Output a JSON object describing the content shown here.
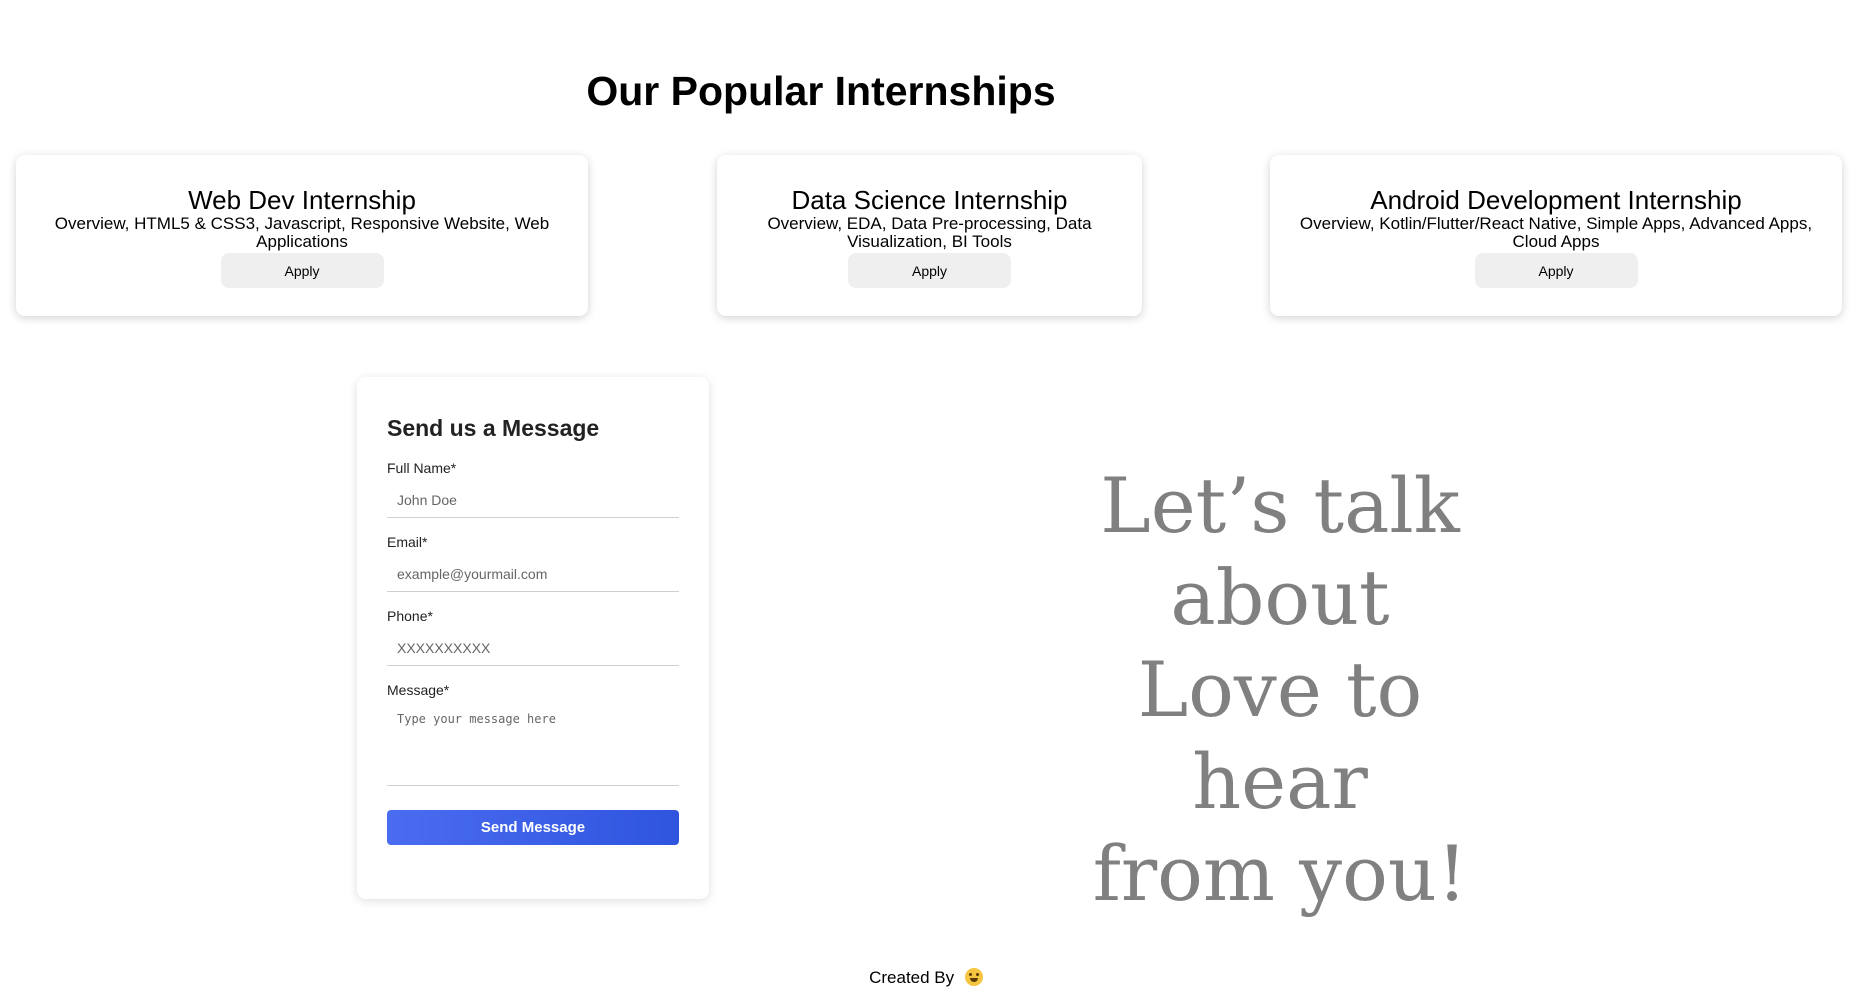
{
  "heading": "Our Popular Internships",
  "internships": [
    {
      "title": "Web Dev Internship",
      "description": "Overview, HTML5 & CSS3, Javascript, Responsive Website, Web Applications",
      "button_label": "Apply"
    },
    {
      "title": "Data Science Internship",
      "description": "Overview, EDA, Data Pre-processing, Data Visualization, BI Tools",
      "button_label": "Apply"
    },
    {
      "title": "Android Development Internship",
      "description": "Overview, Kotlin/Flutter/React Native, Simple Apps, Advanced Apps, Cloud Apps",
      "button_label": "Apply"
    }
  ],
  "contact_form": {
    "title": "Send us a Message",
    "full_name": {
      "label": "Full Name*",
      "placeholder": "John Doe",
      "value": ""
    },
    "email": {
      "label": "Email*",
      "placeholder": "example@yourmail.com",
      "value": ""
    },
    "phone": {
      "label": "Phone*",
      "placeholder": "XXXXXXXXXX",
      "value": ""
    },
    "message": {
      "label": "Message*",
      "placeholder": "Type your message here",
      "value": ""
    },
    "submit_label": "Send Message"
  },
  "talk_text": {
    "line1": "Let’s talk",
    "line2": "about",
    "line3": "Love to hear",
    "line4": "from you!"
  },
  "footer": {
    "text": "Created By",
    "emoji_icon": "smiling-face-emoji-icon"
  },
  "colors": {
    "send_button_gradient_start": "#4a6cf0",
    "send_button_gradient_end": "#2f54de",
    "talk_text": "#808080",
    "apply_button_bg": "#efefef"
  }
}
